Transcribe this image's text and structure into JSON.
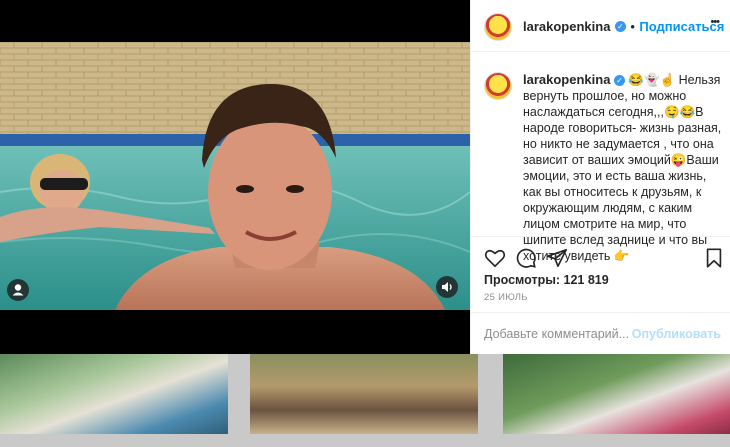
{
  "post": {
    "username": "larakopenkina",
    "follow_label": "Подписаться",
    "more_label": "•••",
    "caption_user": "larakopenkina",
    "caption_text": "😂👻☝️ Нельзя вернуть прошлое, но можно наслаждаться сегодня,,,🤤😂В народе говориться- жизнь разная, но никто не задумается , что она зависит от ваших эмоций😜Ваши эмоции, это и есть ваша жизнь, как вы относитесь к друзьям, к окружающим людям, с каким лицом смотрите на мир, что шипите вслед заднице и что вы хотите увидеть 👉",
    "views_label": "Просмотры: 121 819",
    "date": "25 ИЮЛЬ",
    "comment_placeholder": "Добавьте комментарий...",
    "publish_label": "Опубликовать"
  },
  "icons": [
    "user-tag-icon",
    "sound-icon",
    "heart-icon",
    "comment-icon",
    "share-icon",
    "bookmark-icon",
    "verified-icon"
  ],
  "colors": {
    "accent": "#0095f6",
    "publish_disabled": "#b2dffc",
    "verified": "#3897f0"
  }
}
